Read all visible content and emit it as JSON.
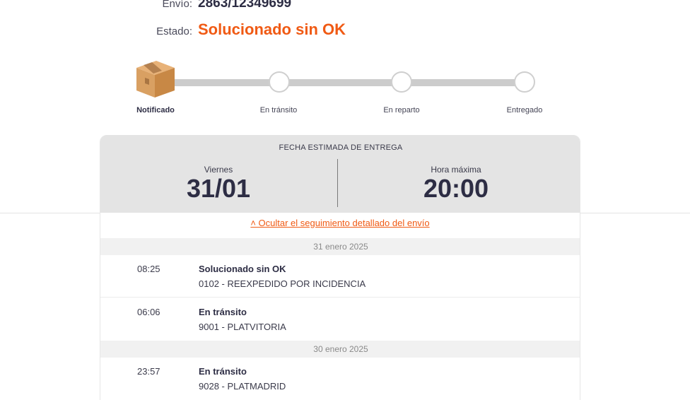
{
  "shipment": {
    "envio_label": "Envío:",
    "envio_value": "2863/12349699",
    "estado_label": "Estado:",
    "estado_value": "Solucionado sin OK"
  },
  "tracker": {
    "steps": [
      {
        "label": "Notificado",
        "active": true,
        "icon": "package-box-icon"
      },
      {
        "label": "En tránsito",
        "active": false
      },
      {
        "label": "En reparto",
        "active": false
      },
      {
        "label": "Entregado",
        "active": false
      }
    ]
  },
  "delivery": {
    "title": "FECHA ESTIMADA DE ENTREGA",
    "day_label": "Viernes",
    "date_value": "31/01",
    "time_label": "Hora máxima",
    "time_value": "20:00"
  },
  "toggle_link": "˄ Ocultar el seguimiento detallado del envío",
  "history": [
    {
      "date": "31 enero 2025",
      "events": [
        {
          "time": "08:25",
          "status": "Solucionado sin OK",
          "detail": "0102 - REEXPEDIDO POR INCIDENCIA"
        },
        {
          "time": "06:06",
          "status": "En tránsito",
          "detail": "9001 - PLATVITORIA"
        }
      ]
    },
    {
      "date": "30 enero 2025",
      "events": [
        {
          "time": "23:57",
          "status": "En tránsito",
          "detail": "9028 - PLATMADRID"
        }
      ]
    }
  ],
  "colors": {
    "accent": "#f05a14",
    "text_dark": "#2d2d44",
    "track": "#cccccc",
    "panel": "#e4e4e4"
  }
}
